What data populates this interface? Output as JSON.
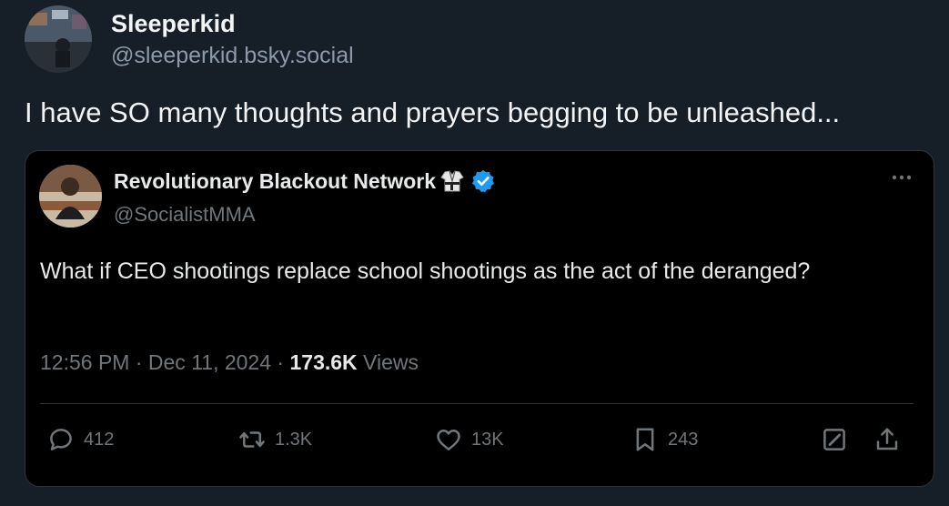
{
  "post": {
    "author_name": "Sleeperkid",
    "author_handle": "@sleeperkid.bsky.social",
    "text": "I have SO many thoughts and prayers begging to be unleashed..."
  },
  "quoted": {
    "name": "Revolutionary Blackout Network",
    "handle": "@SocialistMMA",
    "text": "What if CEO shootings replace school shootings as the act of the deranged?",
    "time": "12:56 PM",
    "date": "Dec 11, 2024",
    "views_count": "173.6K",
    "views_label": "Views",
    "separator": "·",
    "stats": {
      "replies": "412",
      "reposts": "1.3K",
      "likes": "13K",
      "bookmarks": "243"
    },
    "verified_color": "#1d9bf0"
  }
}
